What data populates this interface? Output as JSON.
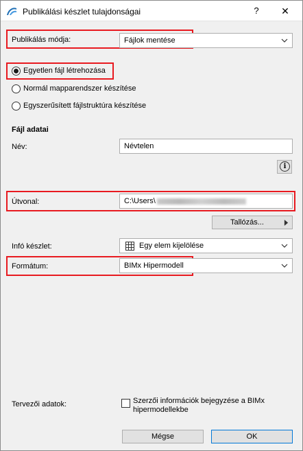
{
  "window": {
    "title": "Publikálási készlet tulajdonságai",
    "help_label": "?",
    "close_label": "✕"
  },
  "publish_mode": {
    "label": "Publikálás módja:",
    "value": "Fájlok mentése"
  },
  "options": [
    {
      "label": "Egyetlen fájl létrehozása",
      "checked": true
    },
    {
      "label": "Normál mapparendszer készítése",
      "checked": false
    },
    {
      "label": "Egyszerűsített fájlstruktúra készítése",
      "checked": false
    }
  ],
  "file_data": {
    "heading": "Fájl adatai",
    "name_label": "Név:",
    "name_value": "Névtelen",
    "info_icon": "info-icon",
    "path_label": "Útvonal:",
    "path_value": "C:\\Users\\",
    "browse_label": "Tallózás..."
  },
  "info_set": {
    "label": "Infó készlet:",
    "value": "Egy elem kijelölése"
  },
  "format": {
    "label": "Formátum:",
    "value": "BIMx Hipermodell"
  },
  "designer": {
    "label": "Tervezői adatok:",
    "checkbox_text_line1": "Szerzői információk bejegyzése a BIMx",
    "checkbox_text_line2": "hipermodellekbe",
    "checked": false
  },
  "footer": {
    "cancel_label": "Mégse",
    "ok_label": "OK"
  },
  "colors": {
    "highlight": "#e8191f",
    "accent": "#0078d7",
    "background": "#f0f0f0"
  }
}
